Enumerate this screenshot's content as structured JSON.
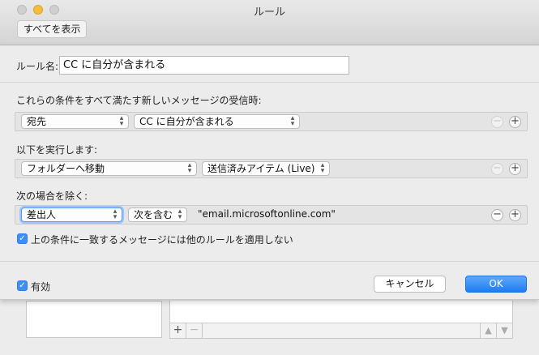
{
  "window": {
    "title": "ルール"
  },
  "toolbar": {
    "show_all_label": "すべてを表示"
  },
  "rule_name": {
    "label": "ルール名:",
    "value": "CC に自分が含まれる"
  },
  "conditions": {
    "header": "これらの条件をすべて満たす新しいメッセージの受信時:",
    "rows": [
      {
        "field": "宛先",
        "operator": "CC に自分が含まれる"
      }
    ]
  },
  "actions": {
    "header": "以下を実行します:",
    "rows": [
      {
        "action": "フォルダーへ移動",
        "target": "送信済みアイテム (Live)"
      }
    ]
  },
  "exceptions": {
    "header": "次の場合を除く:",
    "rows": [
      {
        "field": "差出人",
        "operator": "次を含む",
        "value": "\"email.microsoftonline.com\""
      }
    ]
  },
  "stop_rules": {
    "label": "上の条件に一致するメッセージには他のルールを適用しない",
    "checked": true
  },
  "enabled": {
    "label": "有効",
    "checked": true
  },
  "buttons": {
    "cancel": "キャンセル",
    "ok": "OK",
    "add_glyph": "+",
    "remove_glyph": "−",
    "check_glyph": "✓"
  },
  "colors": {
    "accent": "#1e7cf1",
    "traffic_min": "#f6bd3b"
  }
}
